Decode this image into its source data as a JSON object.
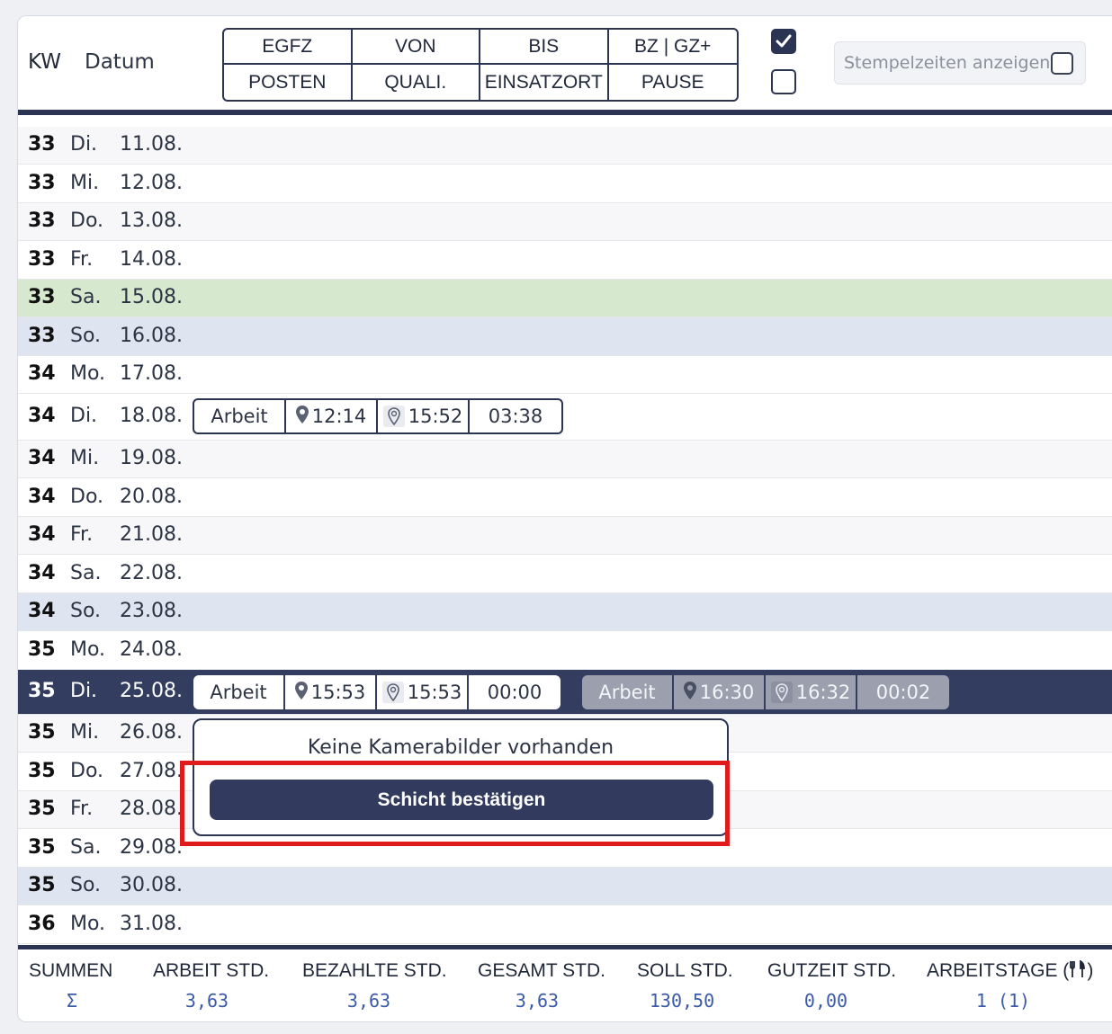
{
  "header": {
    "kw_label": "KW",
    "datum_label": "Datum",
    "legend": [
      "EGFZ",
      "VON",
      "BIS",
      "BZ | GZ+",
      "POSTEN",
      "QUALI.",
      "EINSATZORT",
      "PAUSE"
    ],
    "checkbox_1_checked": true,
    "checkbox_2_checked": false,
    "stempelzeiten_label": "Stempelzeiten anzeigen",
    "stempelzeiten_checked": false
  },
  "rows": [
    {
      "kw": "33",
      "day": "Di.",
      "date": "11.08."
    },
    {
      "kw": "33",
      "day": "Mi.",
      "date": "12.08."
    },
    {
      "kw": "33",
      "day": "Do.",
      "date": "13.08."
    },
    {
      "kw": "33",
      "day": "Fr.",
      "date": "14.08."
    },
    {
      "kw": "33",
      "day": "Sa.",
      "date": "15.08."
    },
    {
      "kw": "33",
      "day": "So.",
      "date": "16.08."
    },
    {
      "kw": "34",
      "day": "Mo.",
      "date": "17.08."
    },
    {
      "kw": "34",
      "day": "Di.",
      "date": "18.08."
    },
    {
      "kw": "34",
      "day": "Mi.",
      "date": "19.08."
    },
    {
      "kw": "34",
      "day": "Do.",
      "date": "20.08."
    },
    {
      "kw": "34",
      "day": "Fr.",
      "date": "21.08."
    },
    {
      "kw": "34",
      "day": "Sa.",
      "date": "22.08."
    },
    {
      "kw": "34",
      "day": "So.",
      "date": "23.08."
    },
    {
      "kw": "35",
      "day": "Mo.",
      "date": "24.08."
    },
    {
      "kw": "35",
      "day": "Di.",
      "date": "25.08."
    },
    {
      "kw": "35",
      "day": "Mi.",
      "date": "26.08."
    },
    {
      "kw": "35",
      "day": "Do.",
      "date": "27.08."
    },
    {
      "kw": "35",
      "day": "Fr.",
      "date": "28.08."
    },
    {
      "kw": "35",
      "day": "Sa.",
      "date": "29.08."
    },
    {
      "kw": "35",
      "day": "So.",
      "date": "30.08."
    },
    {
      "kw": "36",
      "day": "Mo.",
      "date": "31.08."
    }
  ],
  "shifts": {
    "s18": {
      "type": "Arbeit",
      "von": "12:14",
      "bis": "15:52",
      "dauer": "03:38"
    },
    "s25a": {
      "type": "Arbeit",
      "von": "15:53",
      "bis": "15:53",
      "dauer": "00:00"
    },
    "s25b": {
      "type": "Arbeit",
      "von": "16:30",
      "bis": "16:32",
      "dauer": "00:02"
    }
  },
  "popup": {
    "message": "Keine Kamerabilder vorhanden",
    "button": "Schicht bestätigen"
  },
  "summary": {
    "headers": [
      "SUMMEN",
      "ARBEIT STD.",
      "BEZAHLTE STD.",
      "GESAMT STD.",
      "SOLL STD.",
      "GUTZEIT STD.",
      "ARBEITSTAGE ("
    ],
    "values": [
      "Σ",
      "3,63",
      "3,63",
      "3,63",
      "130,50",
      "0,00",
      "1 (1)"
    ]
  },
  "colors": {
    "navy": "#2b3452",
    "selected_row": "#333d5f",
    "holiday_green": "#d6e8cd",
    "sunday_blue": "#dfe5f0",
    "highlight_red": "#e01b1b",
    "sum_value_blue": "#3b5aa8"
  }
}
